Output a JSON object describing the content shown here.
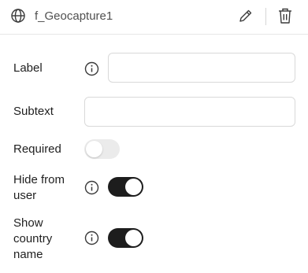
{
  "header": {
    "title": "f_Geocapture1",
    "globe_icon": "globe-icon",
    "edit_icon": "pencil-icon",
    "delete_icon": "trash-icon"
  },
  "fields": {
    "label": {
      "label": "Label",
      "value": "",
      "placeholder": ""
    },
    "subtext": {
      "label": "Subtext",
      "value": "",
      "placeholder": ""
    },
    "required": {
      "label": "Required",
      "on": false
    },
    "hide_from_user": {
      "label_line1": "Hide from",
      "label_line2": "user",
      "on": true
    },
    "show_country_name": {
      "label_line1": "Show",
      "label_line2": "country",
      "label_line3": "name",
      "on": true
    }
  },
  "colors": {
    "toggle_on": "#1d1d1d",
    "toggle_off": "#ebebeb",
    "border": "#d9d9d9"
  }
}
